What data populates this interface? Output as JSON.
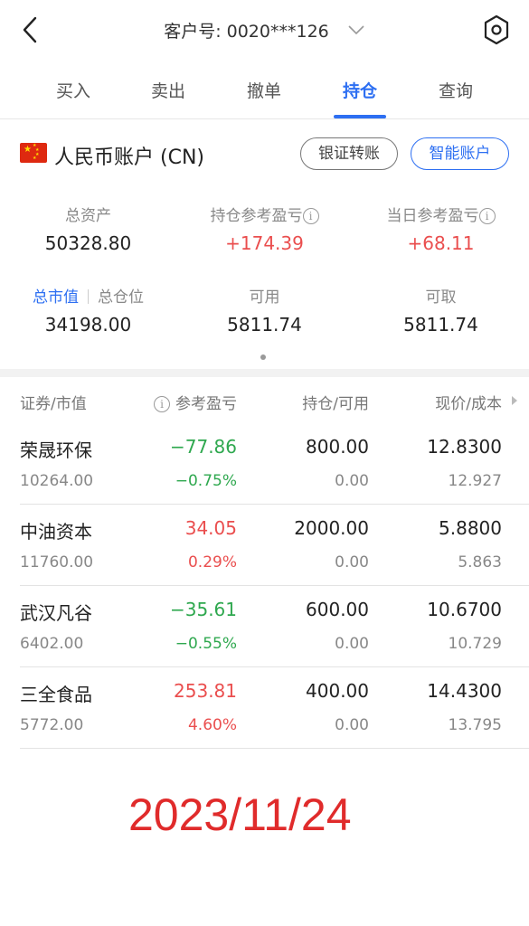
{
  "header": {
    "account_label": "客户号: 0020***126",
    "back_icon": "chevron-left-icon",
    "dropdown_icon": "chevron-down-icon",
    "settings_icon": "hexagon-settings-icon"
  },
  "tabs": [
    {
      "label": "买入",
      "active": false
    },
    {
      "label": "卖出",
      "active": false
    },
    {
      "label": "撤单",
      "active": false
    },
    {
      "label": "持仓",
      "active": true
    },
    {
      "label": "查询",
      "active": false
    }
  ],
  "account": {
    "flag_icon": "china-flag-icon",
    "name": "人民币账户 (CN)",
    "transfer_button": "银证转账",
    "smart_button": "智能账户"
  },
  "summary": {
    "total_assets_label": "总资产",
    "total_assets": "50328.80",
    "position_pl_label": "持仓参考盈亏",
    "position_pl": "+174.39",
    "daily_pl_label": "当日参考盈亏",
    "daily_pl": "+68.11",
    "market_value_label": "总市值",
    "total_position_label": "总仓位",
    "market_value": "34198.00",
    "available_label": "可用",
    "available": "5811.74",
    "withdrawable_label": "可取",
    "withdrawable": "5811.74"
  },
  "table": {
    "headers": {
      "security": "证券/市值",
      "pl": "参考盈亏",
      "holding": "持仓/可用",
      "price": "现价/成本"
    },
    "rows": [
      {
        "name": "荣晟环保",
        "market_value": "10264.00",
        "pl": "−77.86",
        "pl_pct": "−0.75%",
        "trend": "down",
        "holding": "800.00",
        "available": "0.00",
        "price": "12.8300",
        "cost": "12.927"
      },
      {
        "name": "中油资本",
        "market_value": "11760.00",
        "pl": "34.05",
        "pl_pct": "0.29%",
        "trend": "up",
        "holding": "2000.00",
        "available": "0.00",
        "price": "5.8800",
        "cost": "5.863"
      },
      {
        "name": "武汉凡谷",
        "market_value": "6402.00",
        "pl": "−35.61",
        "pl_pct": "−0.55%",
        "trend": "down",
        "holding": "600.00",
        "available": "0.00",
        "price": "10.6700",
        "cost": "10.729"
      },
      {
        "name": "三全食品",
        "market_value": "5772.00",
        "pl": "253.81",
        "pl_pct": "4.60%",
        "trend": "up",
        "holding": "400.00",
        "available": "0.00",
        "price": "14.4300",
        "cost": "13.795"
      }
    ]
  },
  "date_stamp": "2023/11/24",
  "colors": {
    "accent": "#2d6ff2",
    "gain": "#ea4e4e",
    "loss": "#2fa84f",
    "stamp": "#e02b2b"
  }
}
